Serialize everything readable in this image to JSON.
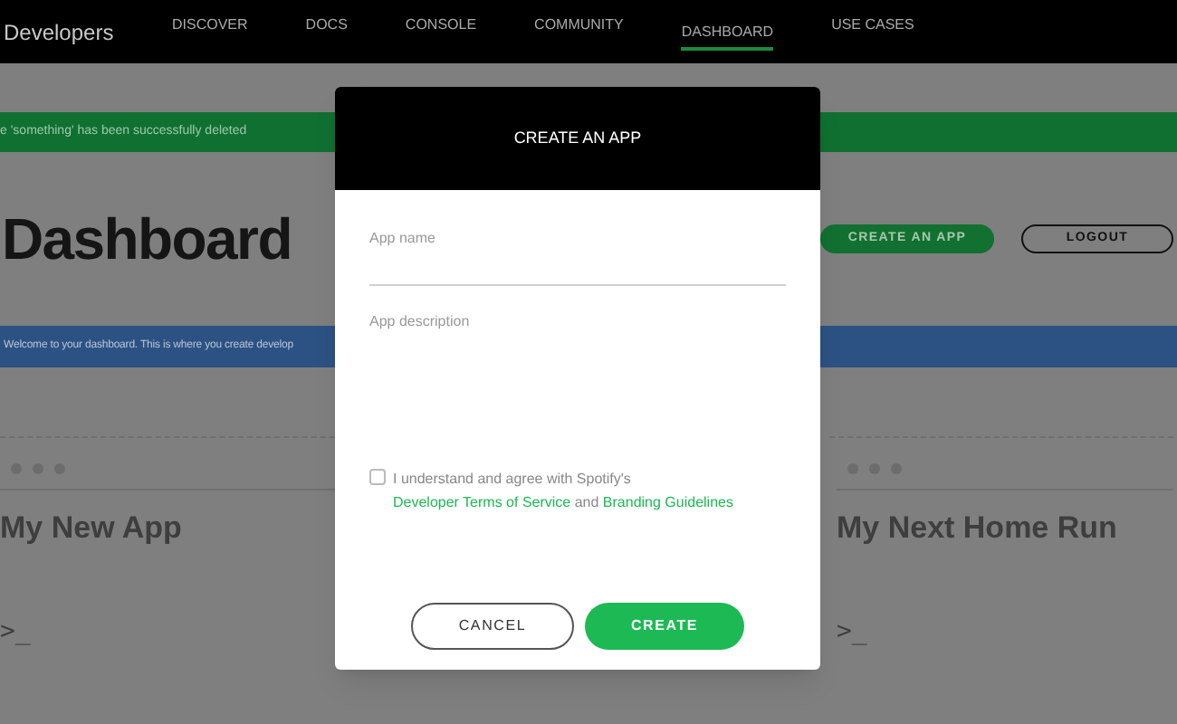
{
  "nav": {
    "brand": "Developers",
    "items": [
      {
        "label": "DISCOVER",
        "selected": false
      },
      {
        "label": "DOCS",
        "selected": false
      },
      {
        "label": "CONSOLE",
        "selected": false
      },
      {
        "label": "COMMUNITY",
        "selected": false
      },
      {
        "label": "DASHBOARD",
        "selected": true
      },
      {
        "label": "USE CASES",
        "selected": false
      }
    ]
  },
  "success_banner": "e 'something' has been successfully deleted",
  "page_title": "Dashboard",
  "actions": {
    "create": "CREATE AN APP",
    "logout": "LOGOUT"
  },
  "info_banner": "Welcome to your dashboard. This is where you create develop",
  "cards": [
    {
      "title": "My New App",
      "prompt": ">_"
    },
    {
      "title": "My Next Home Run",
      "prompt": ">_"
    }
  ],
  "modal": {
    "title": "CREATE AN APP",
    "name_field": {
      "placeholder": "App name"
    },
    "description_field": {
      "placeholder": "App description"
    },
    "agree": {
      "checked": false,
      "text": "I understand and agree with Spotify's ",
      "link1": "Developer Terms of Service",
      "middle": " and ",
      "link2": "Branding Guidelines"
    },
    "cancel": "CANCEL",
    "submit": "CREATE"
  }
}
